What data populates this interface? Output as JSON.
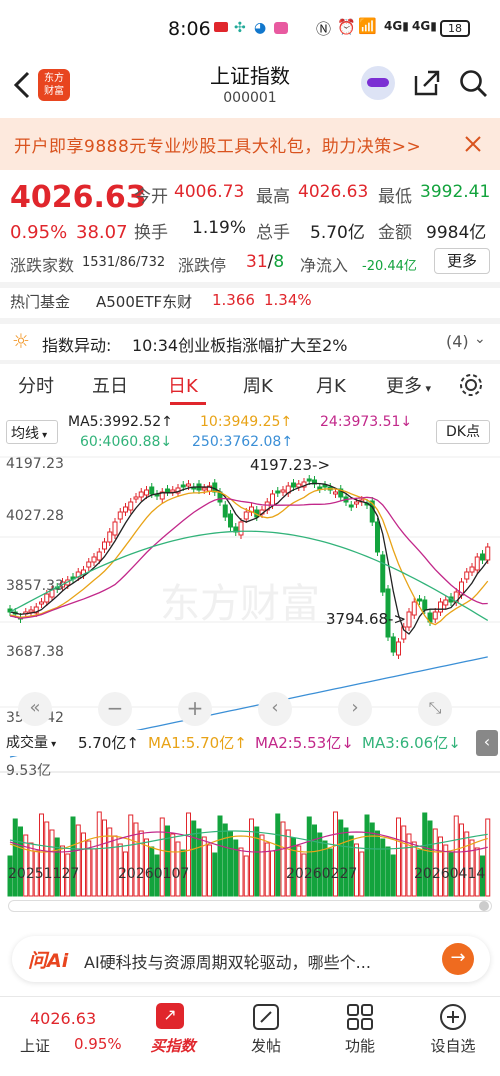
{
  "status": {
    "time": "8:06",
    "battery": "18"
  },
  "nav": {
    "title": "上证指数",
    "code": "000001",
    "logo_line1": "东方",
    "logo_line2": "财富"
  },
  "banner": {
    "text": "开户即享9888元专业炒股工具大礼包，助力决策>>"
  },
  "quote": {
    "price": "4026.63",
    "pct": "0.95%",
    "chg": "38.07",
    "open_label": "今开",
    "open": "4006.73",
    "high_label": "最高",
    "high": "4026.63",
    "low_label": "最低",
    "low": "3992.41",
    "turnover_label": "换手",
    "turnover": "1.19%",
    "volume_label": "总手",
    "volume": "5.70亿",
    "amount_label": "金额",
    "amount": "9984亿",
    "breadth_label": "涨跌家数",
    "breadth": "1531/86/732",
    "limit_label": "涨跌停",
    "limit_up": "31",
    "limit_slash": "/",
    "limit_down": "8",
    "inflow_label": "净流入",
    "inflow": "-20.44亿",
    "more": "更多"
  },
  "hot": {
    "label": "热门基金",
    "fund": "A500ETF东财",
    "price": "1.366",
    "pct": "1.34%"
  },
  "alert": {
    "label": "指数异动:",
    "text": "10:34创业板指涨幅扩大至2%",
    "count": "(4)"
  },
  "tabs": [
    "分时",
    "五日",
    "日K",
    "周K",
    "月K",
    "更多"
  ],
  "ma": {
    "selector": "均线",
    "ma5": "MA5:3992.52↑",
    "ma10": "10:3949.25↑",
    "ma24": "24:3973.51↓",
    "ma60": "60:4060.88↓",
    "ma250": "250:3762.08↑",
    "dk": "DK点"
  },
  "axis": {
    "y1": "4197.23",
    "y2": "4027.28",
    "y3": "3857.33",
    "y4": "3687.38",
    "y5": "3517.42",
    "hi": "4197.23->",
    "lo": "3794.68->",
    "watermark": "东方财富"
  },
  "volume": {
    "selector": "成交量",
    "v": "5.70亿↑",
    "ma1": "MA1:5.70亿↑",
    "ma2": "MA2:5.53亿↓",
    "ma3": "MA3:6.06亿↓",
    "max": "9.53亿"
  },
  "dates": [
    "20251127",
    "20260107",
    "20260227",
    "20260414"
  ],
  "ai": {
    "brand": "问Ai",
    "text": "AI硬科技与资源周期双轮驱动，哪些个..."
  },
  "bottom": {
    "price": "4026.63",
    "name": "上证",
    "pct": "0.95%",
    "buy": "买指数",
    "post": "发帖",
    "func": "功能",
    "watch": "设自选"
  },
  "colors": {
    "up": "#e0262c",
    "down": "#13a33d",
    "ma5": "#222222",
    "ma10": "#e8a317",
    "ma24": "#c2288a",
    "ma60": "#32b37a",
    "ma250": "#3b8fd6"
  }
}
